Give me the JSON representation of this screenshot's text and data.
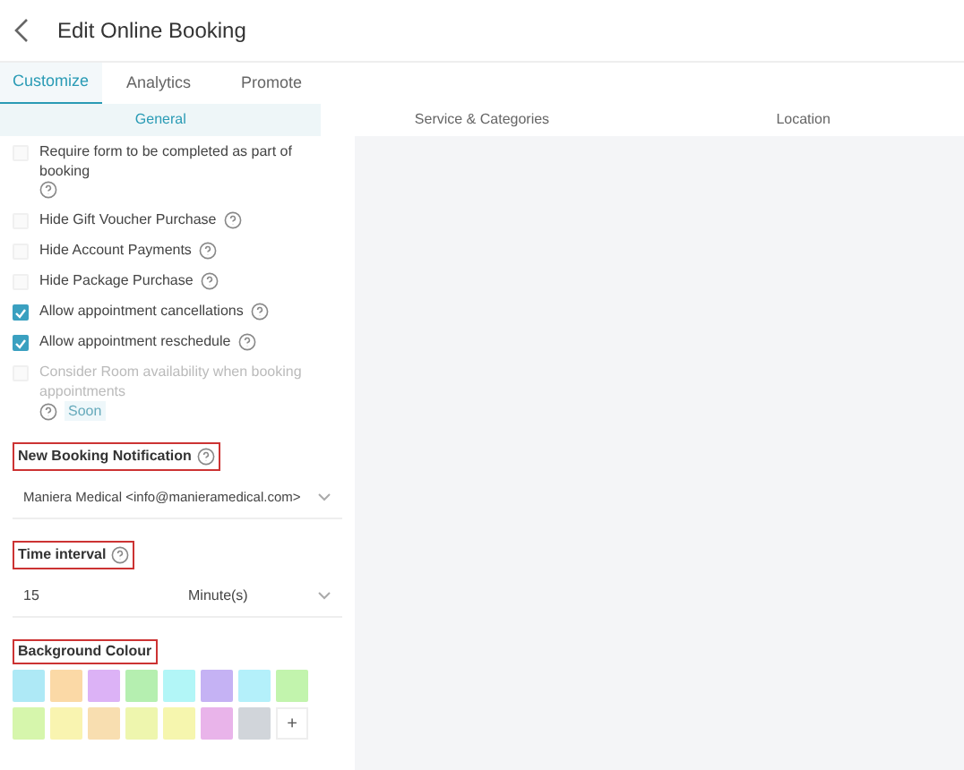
{
  "header": {
    "title": "Edit Online Booking"
  },
  "tabs": [
    {
      "label": "Customize",
      "selected": true
    },
    {
      "label": "Analytics",
      "selected": false
    },
    {
      "label": "Promote",
      "selected": false
    }
  ],
  "subtabs": [
    {
      "label": "General",
      "selected": true
    },
    {
      "label": "Service & Categories",
      "selected": false
    },
    {
      "label": "Location",
      "selected": false
    }
  ],
  "options": [
    {
      "label": "Require form to be completed as part of booking",
      "checked": false,
      "disabled": false
    },
    {
      "label": "Hide Gift Voucher Purchase",
      "checked": false,
      "disabled": false
    },
    {
      "label": "Hide Account Payments",
      "checked": false,
      "disabled": false
    },
    {
      "label": "Hide Package Purchase",
      "checked": false,
      "disabled": false
    },
    {
      "label": "Allow appointment cancellations",
      "checked": true,
      "disabled": false
    },
    {
      "label": "Allow appointment reschedule",
      "checked": true,
      "disabled": false
    },
    {
      "label": "Consider Room availability when booking appointments",
      "checked": false,
      "disabled": true,
      "badge": "Soon"
    }
  ],
  "notification": {
    "label": "New Booking Notification",
    "value": "Maniera Medical <info@manieramedical.com>"
  },
  "time_interval": {
    "label": "Time interval",
    "value": "15",
    "unit": "Minute(s)"
  },
  "background_colour": {
    "label": "Background Colour",
    "swatches": [
      {
        "color": "#aee9f6"
      },
      {
        "color": "#fbd9a6"
      },
      {
        "color": "#dcb2f6"
      },
      {
        "color": "#b5efb0"
      },
      {
        "color": "#b2f6f7"
      },
      {
        "color": "#c5b2f4"
      },
      {
        "color": "#b4f0fa"
      },
      {
        "color": "#c2f4ad"
      },
      {
        "color": "#d6f6ac"
      },
      {
        "color": "#f9f4b0"
      },
      {
        "color": "#f8deb0"
      },
      {
        "color": "#eef6ae"
      },
      {
        "color": "#f6f6ae"
      },
      {
        "color": "#e9b4ea"
      },
      {
        "color": "#d1d5da"
      }
    ],
    "add": "+"
  }
}
